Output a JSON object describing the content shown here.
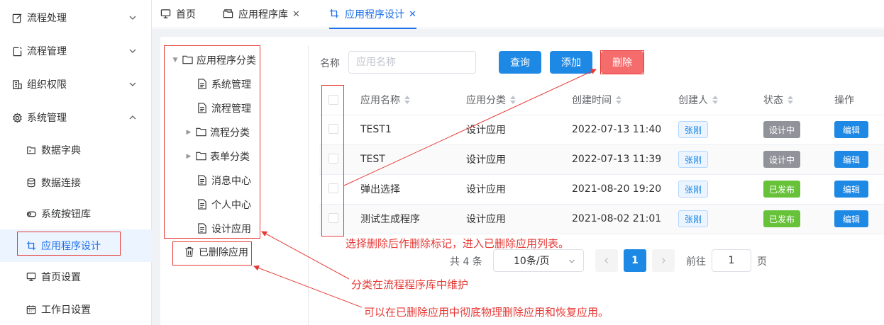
{
  "sidebar": {
    "items": [
      {
        "label": "流程处理",
        "icon": "edit-icon",
        "expanded": false
      },
      {
        "label": "流程管理",
        "icon": "file-edit-icon",
        "expanded": false
      },
      {
        "label": "组织权限",
        "icon": "building-icon",
        "expanded": false
      },
      {
        "label": "系统管理",
        "icon": "gear-icon",
        "expanded": true
      }
    ],
    "subitems": [
      {
        "label": "数据字典",
        "icon": "dictionary-icon"
      },
      {
        "label": "数据连接",
        "icon": "database-icon"
      },
      {
        "label": "系统按钮库",
        "icon": "toggle-icon"
      },
      {
        "label": "应用程序设计",
        "icon": "crop-icon",
        "active": true
      },
      {
        "label": "首页设置",
        "icon": "monitor-icon"
      },
      {
        "label": "工作日设置",
        "icon": "calendar-icon"
      }
    ]
  },
  "tabs": [
    {
      "label": "首页",
      "icon": "monitor-icon",
      "closable": false
    },
    {
      "label": "应用程序库",
      "icon": "folder-icon",
      "closable": true
    },
    {
      "label": "应用程序设计",
      "icon": "crop-icon",
      "closable": true,
      "active": true
    }
  ],
  "tree": {
    "root": "应用程序分类",
    "children": [
      {
        "label": "系统管理",
        "expandable": false
      },
      {
        "label": "流程管理",
        "expandable": false
      },
      {
        "label": "流程分类",
        "expandable": true
      },
      {
        "label": "表单分类",
        "expandable": true
      },
      {
        "label": "消息中心",
        "expandable": false
      },
      {
        "label": "个人中心",
        "expandable": false
      },
      {
        "label": "设计应用",
        "expandable": false
      }
    ],
    "deleted": "已删除应用"
  },
  "search": {
    "label": "名称",
    "placeholder": "应用名称",
    "query_label": "查询",
    "add_label": "添加",
    "delete_label": "删除"
  },
  "table": {
    "headers": [
      "应用名称",
      "应用分类",
      "创建时间",
      "创建人",
      "状态",
      "操作"
    ],
    "rows": [
      {
        "name": "TEST1",
        "category": "设计应用",
        "created": "2022-07-13 11:40",
        "creator": "张刚",
        "status": "设计中",
        "status_kind": "draft",
        "action": "编辑"
      },
      {
        "name": "TEST",
        "category": "设计应用",
        "created": "2022-07-13 11:39",
        "creator": "张刚",
        "status": "设计中",
        "status_kind": "draft",
        "action": "编辑"
      },
      {
        "name": "弹出选择",
        "category": "设计应用",
        "created": "2021-08-20 19:20",
        "creator": "张刚",
        "status": "已发布",
        "status_kind": "published",
        "action": "编辑"
      },
      {
        "name": "测试生成程序",
        "category": "设计应用",
        "created": "2021-08-02 21:01",
        "creator": "张刚",
        "status": "已发布",
        "status_kind": "published",
        "action": "编辑"
      }
    ]
  },
  "pagination": {
    "total_text": "共 4 条",
    "page_size": "10条/页",
    "current_page": "1",
    "goto_label": "前往",
    "goto_value": "1",
    "page_suffix": "页"
  },
  "annotations": {
    "note1": "选择删除后作删除标记，进入已删除应用列表。",
    "note2": "分类在流程程序库中维护",
    "note3": "可以在已删除应用中彻底物理删除应用和恢复应用。"
  },
  "colors": {
    "accent": "#1e88e5",
    "danger": "#f56c6c",
    "published": "#67c23a",
    "draft": "#909399",
    "annotation": "#e53935"
  }
}
